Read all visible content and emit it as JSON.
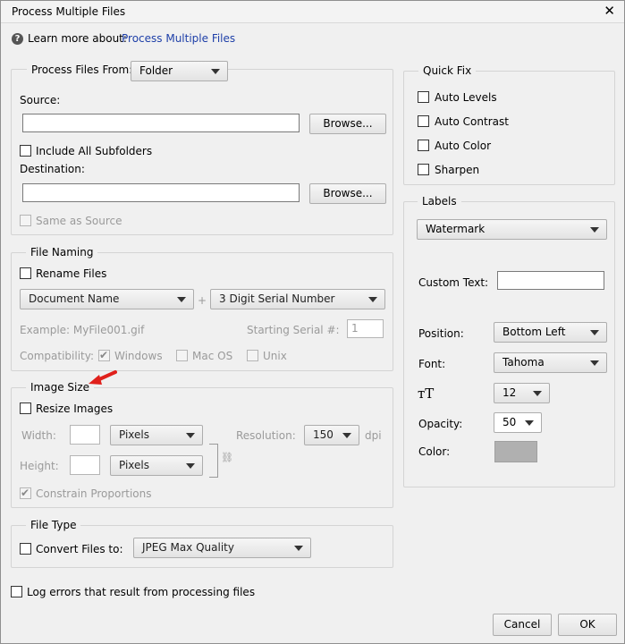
{
  "window": {
    "title": "Process Multiple Files",
    "close_glyph": "✕"
  },
  "help": {
    "icon_glyph": "?",
    "prefix": "Learn more about:",
    "link": "Process Multiple Files"
  },
  "process_from": {
    "label": "Process Files From:",
    "selected": "Folder",
    "source_label": "Source:",
    "source_value": "",
    "browse_label_1": "Browse...",
    "include_subfolders": {
      "label": "Include All Subfolders",
      "checked": false
    },
    "destination_label": "Destination:",
    "destination_value": "",
    "browse_label_2": "Browse...",
    "same_as_source": {
      "label": "Same as Source",
      "checked": false
    }
  },
  "file_naming": {
    "title": "File Naming",
    "rename_files": {
      "label": "Rename Files",
      "checked": false
    },
    "name_selected": "Document Name",
    "plus": "+",
    "serial_selected": "3 Digit Serial Number",
    "example": "Example: MyFile001.gif",
    "starting_serial_label": "Starting Serial #:",
    "starting_serial_value": "1",
    "compatibility_label": "Compatibility:",
    "windows": {
      "label": "Windows",
      "checked": true
    },
    "macos": {
      "label": "Mac OS",
      "checked": false
    },
    "unix": {
      "label": "Unix",
      "checked": false
    }
  },
  "image_size": {
    "title": "Image Size",
    "resize_images": {
      "label": "Resize Images",
      "checked": false
    },
    "width_label": "Width:",
    "width_value": "",
    "width_unit": "Pixels",
    "height_label": "Height:",
    "height_value": "",
    "height_unit": "Pixels",
    "resolution_label": "Resolution:",
    "resolution_value": "150",
    "dpi_label": "dpi",
    "link_glyph": "⛓",
    "constrain": {
      "label": "Constrain Proportions",
      "checked": true
    }
  },
  "file_type": {
    "title": "File Type",
    "convert": {
      "label": "Convert Files to:",
      "checked": false
    },
    "format_selected": "JPEG Max Quality"
  },
  "log_errors": {
    "label": "Log errors that result from processing files",
    "checked": false
  },
  "quick_fix": {
    "title": "Quick Fix",
    "items": [
      {
        "label": "Auto Levels",
        "checked": false
      },
      {
        "label": "Auto Contrast",
        "checked": false
      },
      {
        "label": "Auto Color",
        "checked": false
      },
      {
        "label": "Sharpen",
        "checked": false
      }
    ]
  },
  "labels": {
    "title": "Labels",
    "type_selected": "Watermark",
    "custom_text_label": "Custom Text:",
    "custom_text_value": "",
    "position_label": "Position:",
    "position_selected": "Bottom Left",
    "font_label": "Font:",
    "font_selected": "Tahoma",
    "size_icon_glyph": "ᴛT",
    "size_selected": "12",
    "opacity_label": "Opacity:",
    "opacity_selected": "50",
    "color_label": "Color:",
    "color_value": "#b0b0b0"
  },
  "buttons": {
    "cancel": "Cancel",
    "ok": "OK"
  },
  "annotation_arrow_color": "#e0201b"
}
